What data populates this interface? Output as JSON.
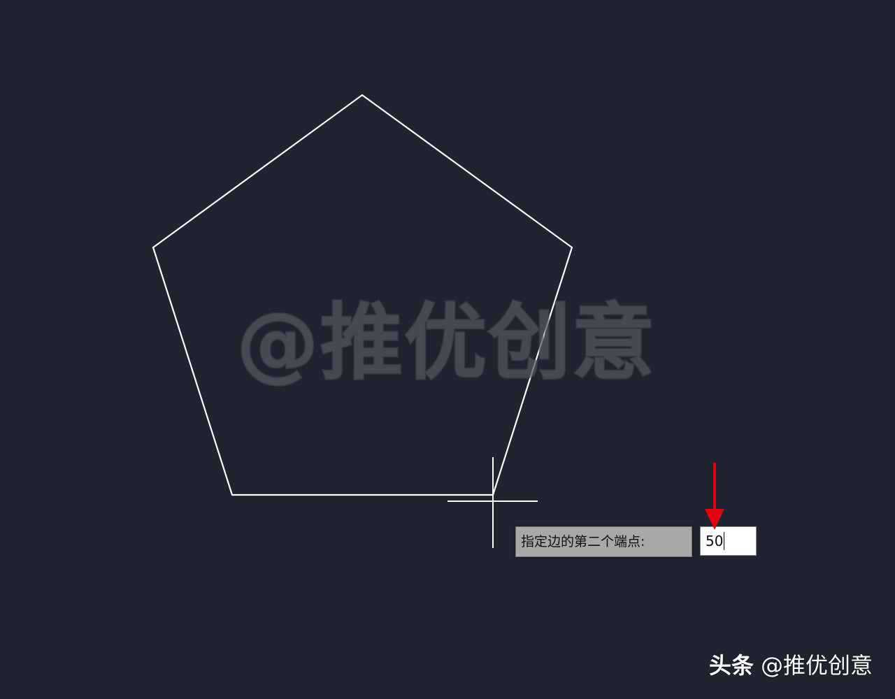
{
  "watermark": {
    "text": "@推优创意"
  },
  "prompt": {
    "label": "指定边的第二个端点:",
    "input_value": "50"
  },
  "brand": {
    "platform": "头条",
    "account": "@推优创意"
  },
  "colors": {
    "background": "#1f2430",
    "lines": "#ffffff",
    "arrow": "#e3000f",
    "prompt_bg": "#a8a8a8"
  },
  "icons": {
    "cursor": "crosshair-cursor-icon",
    "pointer": "red-down-arrow-icon"
  }
}
